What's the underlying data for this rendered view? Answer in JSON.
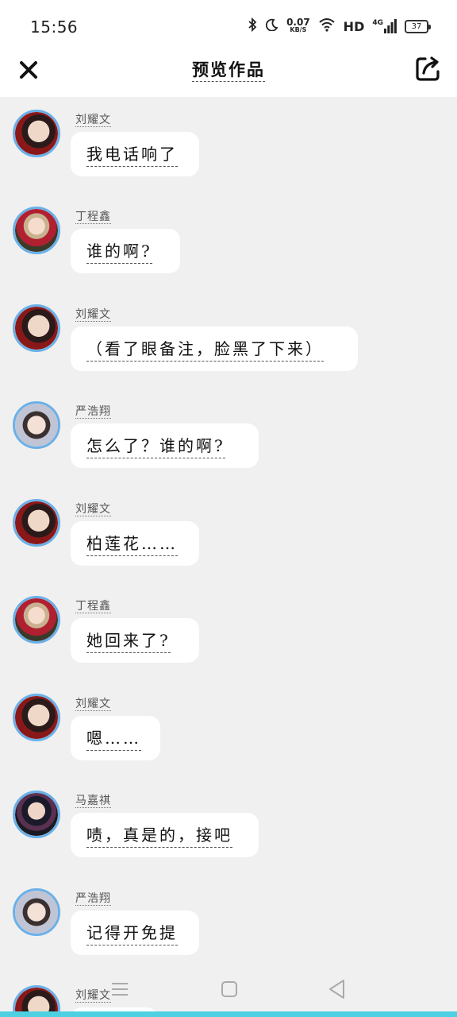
{
  "status_bar": {
    "time": "15:56",
    "net_speed_value": "0.07",
    "net_speed_unit": "KB/S",
    "hd": "HD",
    "network": "4G",
    "battery": "37"
  },
  "header": {
    "title": "预览作品",
    "close_icon": "close-icon",
    "share_icon": "share-icon"
  },
  "colors": {
    "avatar_ring": "#6ab0e8",
    "bottom_bar": "#4dd0e1",
    "background": "#f0f0f0"
  },
  "messages": [
    {
      "name": "刘耀文",
      "text": "我电话响了"
    },
    {
      "name": "丁程鑫",
      "text": "谁的啊?"
    },
    {
      "name": "刘耀文",
      "text": "（看了眼备注，脸黑了下来）"
    },
    {
      "name": "严浩翔",
      "text": "怎么了？谁的啊?"
    },
    {
      "name": "刘耀文",
      "text": "柏莲花……"
    },
    {
      "name": "丁程鑫",
      "text": "她回来了?"
    },
    {
      "name": "刘耀文",
      "text": "嗯……"
    },
    {
      "name": "马嘉祺",
      "text": "啧，真是的，接吧"
    },
    {
      "name": "严浩翔",
      "text": "记得开免提"
    },
    {
      "name": "刘耀文",
      "text": ""
    }
  ],
  "nav_bar": {
    "menu_icon": "menu-icon",
    "home_icon": "home-icon",
    "back_icon": "back-icon"
  }
}
